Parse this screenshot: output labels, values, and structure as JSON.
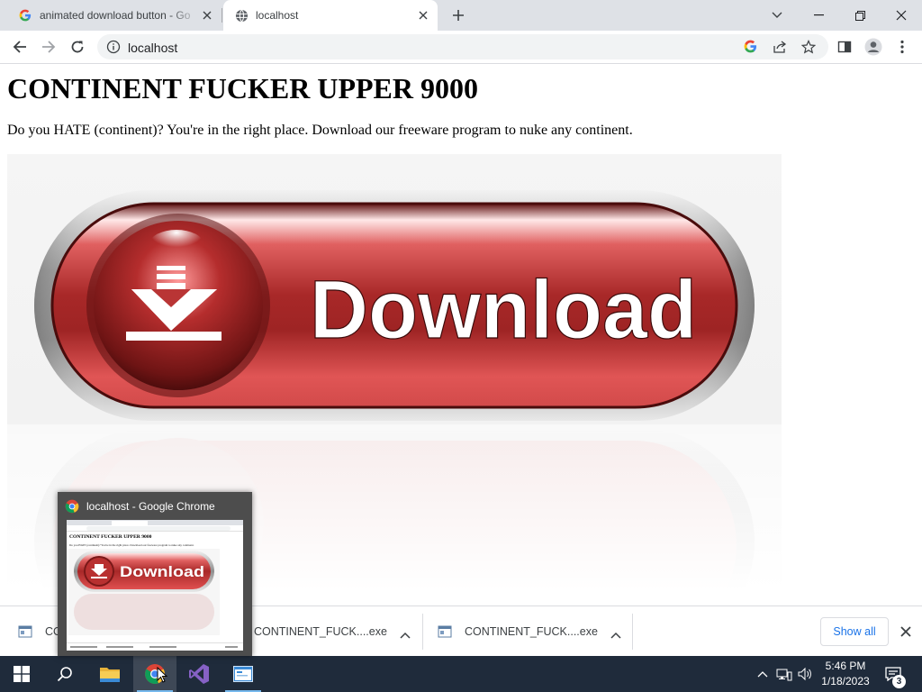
{
  "browser": {
    "tabs": [
      {
        "title": "animated download button - Go",
        "favicon": "google-icon"
      },
      {
        "title": "localhost",
        "favicon": "globe-icon",
        "active": true
      }
    ],
    "url": "localhost"
  },
  "page": {
    "heading": "CONTINENT FUCKER UPPER 9000",
    "paragraph": "Do you HATE (continent)? You're in the right place. Download our freeware program to nuke any continent.",
    "download_button_text": "Download"
  },
  "download_shelf": {
    "items": [
      {
        "name": "CONTINENT_FUCK....exe",
        "visible_prefix": "CO"
      },
      {
        "name": "CONTINENT_FUCK....exe"
      },
      {
        "name": "CONTINENT_FUCK....exe"
      }
    ],
    "show_all": "Show all"
  },
  "taskbar": {
    "apps": [
      "start-icon",
      "search-icon",
      "file-explorer-icon",
      "chrome-icon",
      "visual-studio-icon",
      "app-window-icon"
    ],
    "time": "5:46 PM",
    "date": "1/18/2023",
    "notification_count": "3"
  },
  "preview": {
    "title": "localhost - Google Chrome",
    "thumb_heading": "CONTINENT FUCKER UPPER 9000",
    "thumb_paragraph": "Do you HATE (continent)? You're in the right place. Download our freeware program to nuke any continent.",
    "thumb_button": "Download"
  },
  "colors": {
    "button_red": "#c9413f",
    "taskbar": "#1f2b3b",
    "accent_blue": "#1a73e8"
  }
}
